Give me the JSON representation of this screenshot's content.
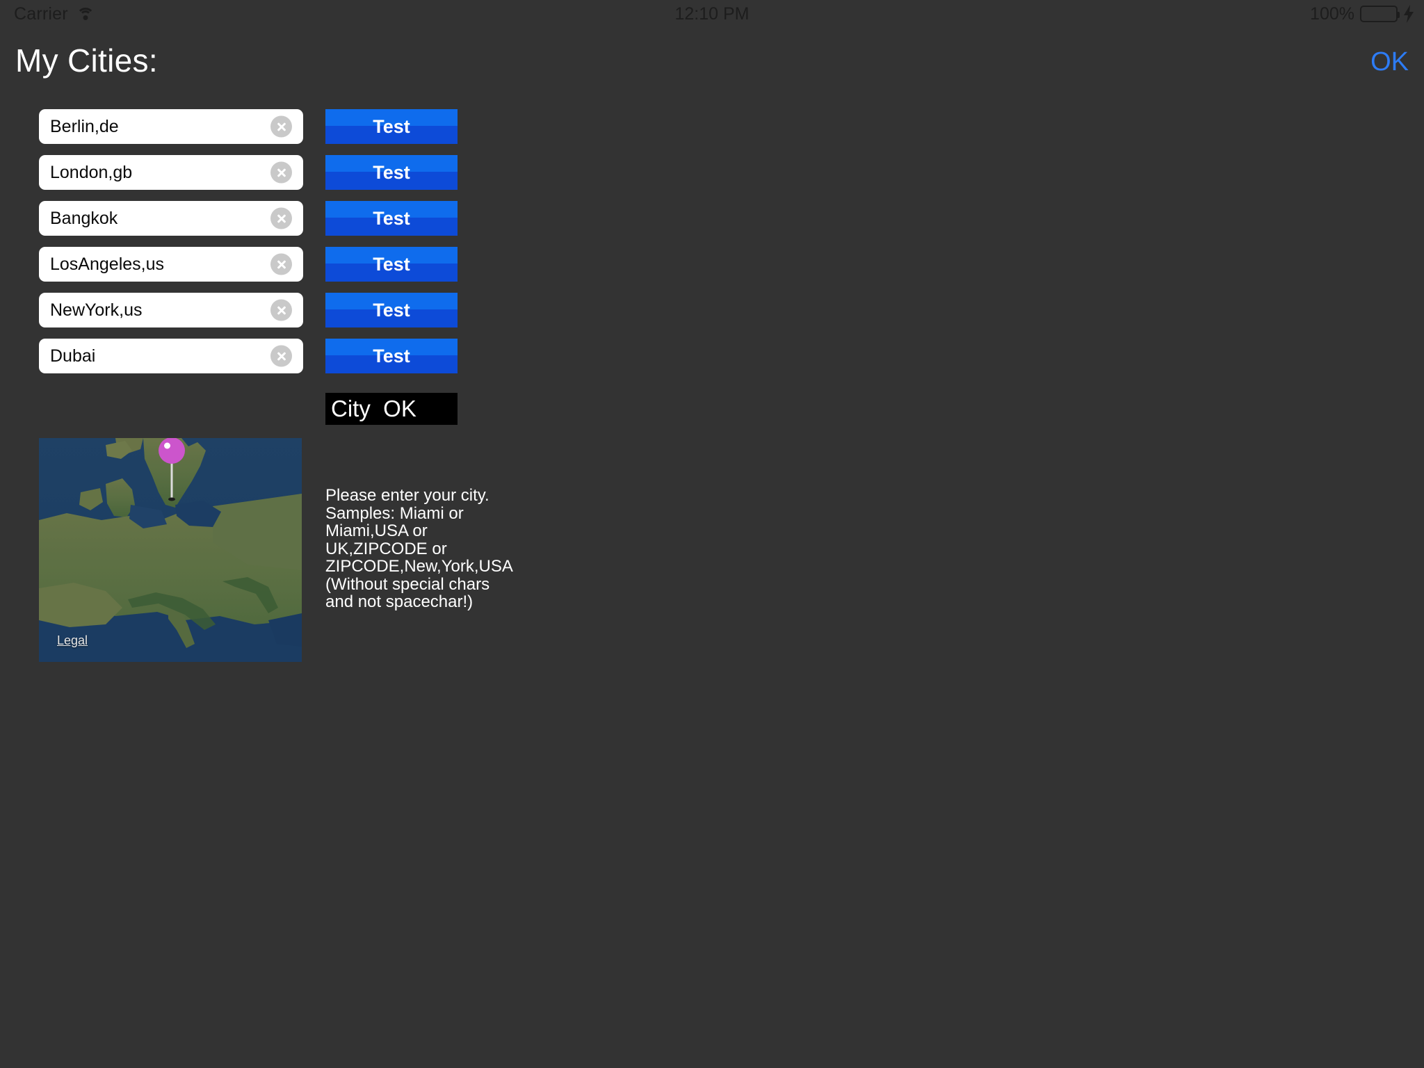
{
  "status_bar": {
    "carrier": "Carrier",
    "wifi_icon": "wifi-icon",
    "time": "12:10 PM",
    "battery_percent": "100%",
    "battery_icon": "battery-full-icon",
    "charging_icon": "lightning-bolt-icon",
    "battery_color": "#4CD763"
  },
  "header": {
    "title": "My Cities:",
    "ok_label": "OK",
    "ok_color": "#2d7cf6"
  },
  "cities": [
    {
      "value": "Berlin,de",
      "clear_icon": "clear-circle-icon",
      "test_label": "Test"
    },
    {
      "value": "London,gb",
      "clear_icon": "clear-circle-icon",
      "test_label": "Test"
    },
    {
      "value": "Bangkok",
      "clear_icon": "clear-circle-icon",
      "test_label": "Test"
    },
    {
      "value": "LosAngeles,us",
      "clear_icon": "clear-circle-icon",
      "test_label": "Test"
    },
    {
      "value": "NewYork,us",
      "clear_icon": "clear-circle-icon",
      "test_label": "Test"
    },
    {
      "value": "Dubai",
      "clear_icon": "clear-circle-icon",
      "test_label": "Test"
    }
  ],
  "status_label": {
    "text": "City  OK",
    "background": "#000000",
    "color": "#ffffff"
  },
  "map": {
    "legal_label": "Legal",
    "pin_icon": "map-pin-icon",
    "pin_color": "#cc55cc",
    "region": "Europe"
  },
  "help": {
    "text": "Please enter your city.\nSamples: Miami or\nMiami,USA or\nUK,ZIPCODE or\nZIPCODE,New,York,USA\n(Without special chars\nand not spacechar!)"
  },
  "theme": {
    "background": "#333333",
    "button_top": "#0f6ced",
    "button_bottom": "#0d4bd8"
  }
}
